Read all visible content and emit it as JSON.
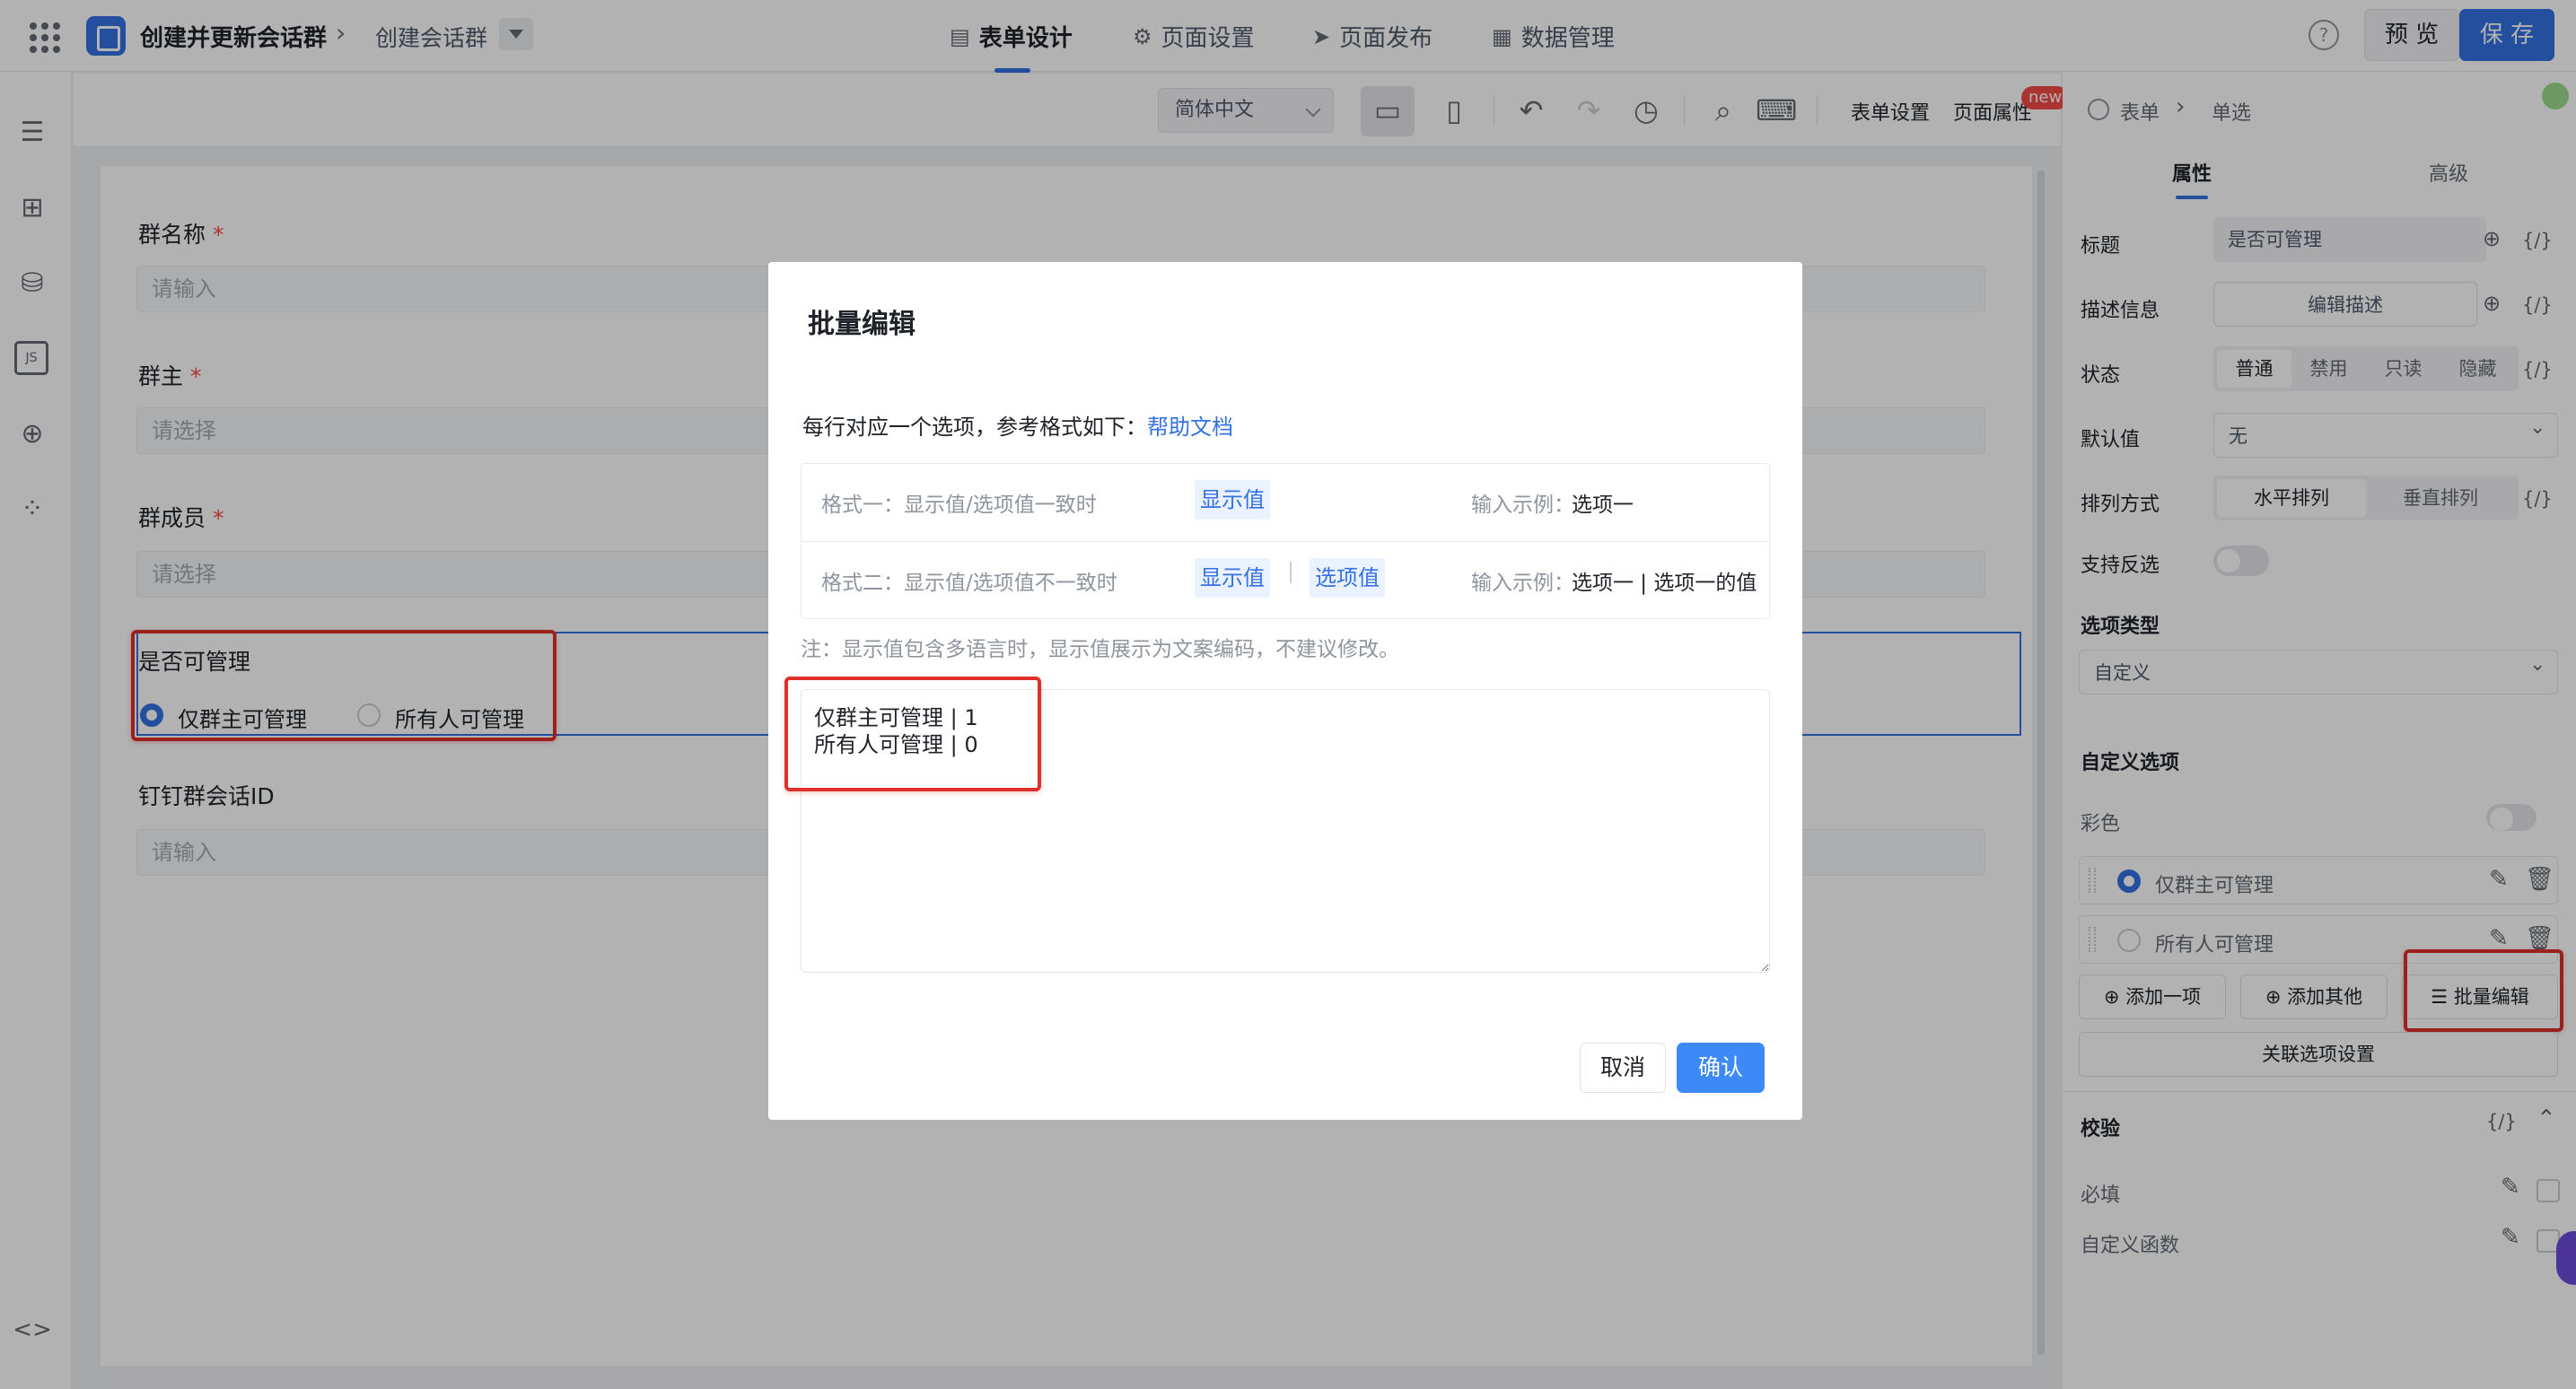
{
  "app": {
    "title": "创建并更新会话群",
    "page_name": "创建会话群"
  },
  "top_tabs": [
    {
      "label": "表单设计",
      "icon": "form-icon"
    },
    {
      "label": "页面设置",
      "icon": "gear-icon"
    },
    {
      "label": "页面发布",
      "icon": "send-icon"
    },
    {
      "label": "数据管理",
      "icon": "table-icon"
    }
  ],
  "header_buttons": {
    "help": "?",
    "preview": "预 览",
    "save": "保 存"
  },
  "toolbar": {
    "language": "简体中文",
    "form_settings": "表单设置",
    "page_properties": "页面属性",
    "new_badge": "new"
  },
  "form": {
    "fields": [
      {
        "label": "群名称",
        "required": "*",
        "placeholder": "请输入"
      },
      {
        "label": "群主",
        "required": "*",
        "placeholder": "请选择"
      },
      {
        "label": "群成员",
        "required": "*",
        "placeholder": "请选择"
      }
    ],
    "radio_field": {
      "label": "是否可管理",
      "options": [
        "仅群主可管理",
        "所有人可管理"
      ],
      "selected": "仅群主可管理"
    },
    "id_field": {
      "label": "钉钉群会话ID",
      "placeholder": "请输入"
    }
  },
  "modal": {
    "title": "批量编辑",
    "description": "每行对应一个选项，参考格式如下：",
    "help_link": "帮助文档",
    "format1": {
      "label": "格式一：显示值/选项值一致时",
      "chip": "显示值",
      "example_label": "输入示例：",
      "example": "选项一"
    },
    "format2": {
      "label": "格式二：显示值/选项值不一致时",
      "chip1": "显示值",
      "chip2": "选项值",
      "example_label": "输入示例：",
      "example": "选项一 | 选项一的值"
    },
    "note": "注：显示值包含多语言时，显示值展示为文案编码，不建议修改。",
    "textarea_value": "仅群主可管理 | 1\n所有人可管理 | 0",
    "cancel": "取消",
    "confirm": "确认"
  },
  "right_panel": {
    "breadcrumb": [
      "表单",
      "单选"
    ],
    "tabs": [
      "属性",
      "高级"
    ],
    "title_label": "标题",
    "title_value": "是否可管理",
    "desc_label": "描述信息",
    "desc_button": "编辑描述",
    "status_label": "状态",
    "status_options": [
      "普通",
      "禁用",
      "只读",
      "隐藏"
    ],
    "default_label": "默认值",
    "default_value": "无",
    "layout_label": "排列方式",
    "layout_options": [
      "水平排列",
      "垂直排列"
    ],
    "deselect_label": "支持反选",
    "option_type_label": "选项类型",
    "option_type_value": "自定义",
    "custom_options_label": "自定义选项",
    "color_label": "彩色",
    "options": [
      "仅群主可管理",
      "所有人可管理"
    ],
    "add_one": "添加一项",
    "add_other": "添加其他",
    "batch_edit": "批量编辑",
    "linked_settings": "关联选项设置",
    "validation_label": "校验",
    "required_label": "必填",
    "custom_func_label": "自定义函数",
    "code_marker": "{/}"
  }
}
